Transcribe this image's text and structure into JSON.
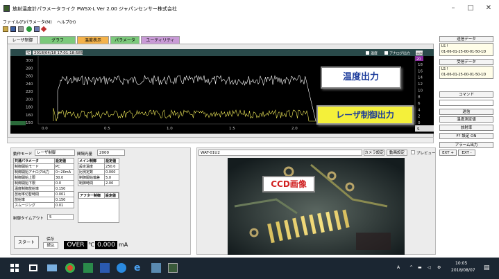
{
  "window": {
    "title": "放射温度計パラメータライク PWSX-L  Ver 2.00     ジャパンセンサー株式会社",
    "minimize": "–",
    "maximize": "□",
    "close": "✕"
  },
  "menu": [
    "ファイル(F)",
    "パラメータ(M)",
    "ヘルプ(H)"
  ],
  "tabs": [
    {
      "label": "レーザ制御",
      "color": "#f4f4f4"
    },
    {
      "label": "グラフ",
      "color": "#7bc97b"
    },
    {
      "label": "温度表示",
      "color": "#f4b24a"
    },
    {
      "label": "パラメータ",
      "color": "#7bc97b"
    },
    {
      "label": "ユーティリティ",
      "color": "#c89ad6"
    }
  ],
  "chart_header": {
    "timestamp": "2018/04/18 17:01:18:585",
    "legend_temp": "温度",
    "legend_analog": "アナログ出力",
    "corner": "auto",
    "left_top": "℃",
    "right_top": "20"
  },
  "chart_data": {
    "type": "line",
    "x_ticks": [
      "0.0",
      "0.5",
      "1.0",
      "1.5",
      "2.0"
    ],
    "y_left_ticks": [
      "300",
      "280",
      "260",
      "240",
      "220",
      "200",
      "180",
      "160",
      "150"
    ],
    "y_right_ticks": [
      "18",
      "16",
      "14",
      "12",
      "10",
      "8",
      "6",
      "4",
      "2",
      "0"
    ],
    "x_unit": "S",
    "series": []
  },
  "annotations": {
    "temp_output": "温度出力",
    "laser_output": "レーザ制御出力",
    "ccd": "CCD画像"
  },
  "sidebar": {
    "send_data": "送信データ",
    "send_line1": "LS !",
    "send_line2": "01-06-01-25-00-01-50-1D",
    "recv_data": "受信データ",
    "recv_line1": "LS !",
    "recv_line2": "01-06-01-25-00-01-50-1D",
    "command": "コマンド",
    "send": "送信",
    "temp_measure": "温度測定値",
    "emissivity": "放射率",
    "fixed": "F? 設定 ON",
    "alarm": "アラーム出力",
    "ext_plus": "EXT +",
    "ext_minus": "EXT -"
  },
  "left_panel": {
    "mode_label": "動作モード",
    "mode_value": "レーザ制御",
    "measure_label": "間隔光量",
    "measure_value": "2000",
    "common_header": [
      "共通パラメータ",
      "設定値"
    ],
    "common_rows": [
      [
        "制御開始モード",
        "PC"
      ],
      [
        "制御開始アナログ出力",
        "0~20mA"
      ],
      [
        "制御開始上限",
        "30.0"
      ],
      [
        "制御開始下限",
        "0.0"
      ],
      [
        "温度制御放射率",
        "0.150"
      ],
      [
        "放射率切替時間",
        "0.001"
      ],
      [
        "放射率",
        "0.150"
      ],
      [
        "スムージング",
        "0.01"
      ]
    ],
    "timeout_label": "制御タイムアウト",
    "timeout_value": "5",
    "main_header": [
      "メイン制御",
      "設定値"
    ],
    "main_rows": [
      [
        "設定温度",
        "250.0"
      ],
      [
        "比例定数",
        "0.000"
      ],
      [
        "制御開始偏差",
        "5.0"
      ],
      [
        "制御時間",
        "2.00"
      ]
    ],
    "after_header": [
      "アフター制御",
      "設定値"
    ],
    "start": "スタート",
    "save": "保存",
    "load": "読込",
    "temp_display": "OVER",
    "temp_unit": "℃",
    "current_display": "0.000",
    "current_unit": "mA"
  },
  "right_panel": {
    "camera": "WAT-01U2",
    "auto_setting": "カメラ設定",
    "param_setting": "動画設定",
    "preview": "プレビュー"
  },
  "taskbar": {
    "time": "10:05",
    "date": "2018/08/07",
    "ime": "A"
  }
}
